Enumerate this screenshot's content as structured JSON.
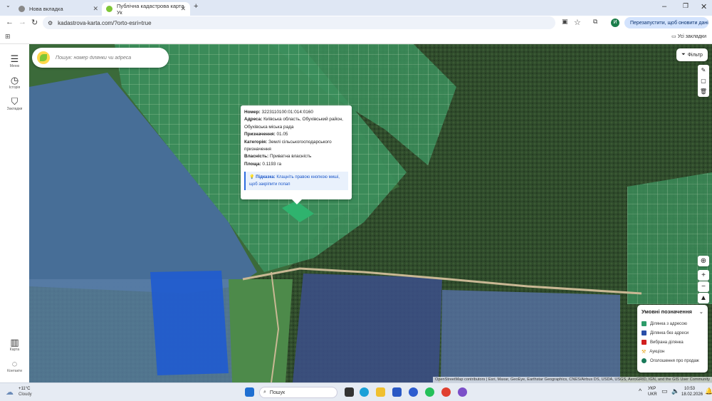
{
  "browser": {
    "tabs": [
      {
        "title": "Нова вкладка",
        "active": false
      },
      {
        "title": "Публічна кадастрова карта Ук",
        "active": true
      }
    ],
    "new_tab_icon": "plus-icon",
    "url": "kadastrova-karta.com/?orto-esri=true",
    "restart_button": "Перезапустити, щоб оновити дані",
    "profile_initial": "И",
    "bookmarks_all": "Усі закладки"
  },
  "sidebar": {
    "menu": "Меню",
    "history": "Історія",
    "bookmarks": "Закладки",
    "map": "Карта",
    "contacts": "Контакти"
  },
  "map": {
    "search_placeholder": "Пошук: номер ділянки чи адреса",
    "filter_button": "Фільтр",
    "attribution": "OpenStreetMap contributors | Esri, Maxar, GeoEye, Earthstar Geographics, CNES/Airbus DS, USDA, USGS, AeroGRID, IGN, and the GIS User Community"
  },
  "popup": {
    "number_label": "Номер:",
    "number_value": "3223110100:01:014:0160",
    "address_label": "Адреса:",
    "address_value": "Київська область, Обухівський район, Обухівська міська рада",
    "purpose_label": "Призначення:",
    "purpose_value": "01.05",
    "category_label": "Категорія:",
    "category_value": "Землі сільськогосподарського призначення",
    "ownership_label": "Власність:",
    "ownership_value": "Приватна власність",
    "area_label": "Площа:",
    "area_value": "0.1193 га",
    "hint_label": "Підказка:",
    "hint_text": "Клацніть правою кнопкою миші, щоб закріпити попап"
  },
  "legend": {
    "title": "Умовні позначення",
    "items": [
      {
        "label": "Ділянка з адресою",
        "color": "#2e9c6a"
      },
      {
        "label": "Ділянка без адреси",
        "color": "#2a4fa8"
      },
      {
        "label": "Вибрана ділянка",
        "color": "#d11f1f"
      },
      {
        "label": "Аукціон",
        "color": "#e8a317"
      },
      {
        "label": "Оголошення про продаж",
        "color": "#1a7a5a"
      }
    ]
  },
  "taskbar": {
    "temperature": "+11°C",
    "weather": "Cloudy",
    "search": "Пошук",
    "lang_line1": "УКР",
    "lang_line2": "UKR",
    "time": "10:53",
    "date": "18.02.2026"
  }
}
